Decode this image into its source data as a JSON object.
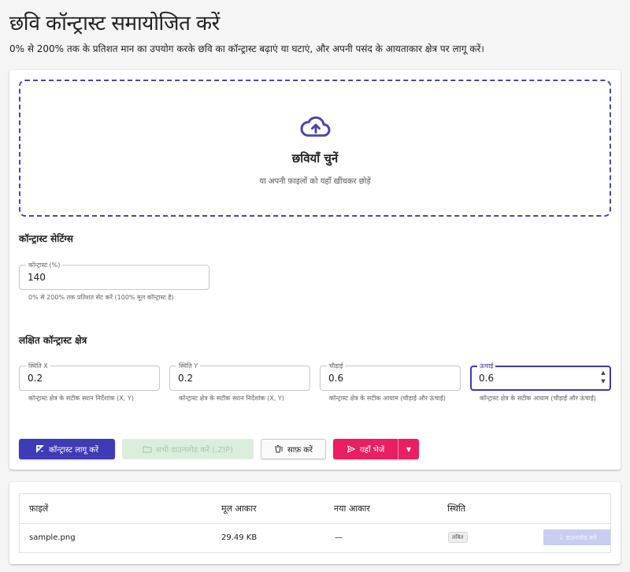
{
  "page": {
    "title": "छवि कॉन्ट्रास्ट समायोजित करें",
    "description": "0% से 200% तक के प्रतिशत मान का उपयोग करके छवि का कॉन्ट्रास्ट बढ़ाएं या घटाएं, और अपनी पसंद के आयताकार क्षेत्र पर लागू करें।"
  },
  "dropzone": {
    "icon": "cloud-upload-icon",
    "title": "छवियाँ चुनें",
    "subtitle": "या अपनी फ़ाइलों को यहाँ खींचकर छोड़ें"
  },
  "contrast_settings": {
    "title": "कॉन्ट्रास्ट सेटिंग्स",
    "contrast_label": "कॉन्ट्रास्ट (%)",
    "contrast_value": "140",
    "contrast_helper": "0% से 200% तक प्रतिशत सेट करें (100% मूल कॉन्ट्रास्ट है)"
  },
  "region": {
    "title": "लक्षित कॉन्ट्रास्ट क्षेत्र",
    "x_label": "स्थिति X",
    "x_value": "0.2",
    "x_helper": "कॉन्ट्रास्ट क्षेत्र के सटीक स्थान निर्देशांक (X, Y)",
    "y_label": "स्थिति Y",
    "y_value": "0.2",
    "y_helper": "कॉन्ट्रास्ट क्षेत्र के सटीक स्थान निर्देशांक (X, Y)",
    "width_label": "चौड़ाई",
    "width_value": "0.6",
    "width_helper": "कॉन्ट्रास्ट क्षेत्र के सटीक आयाम (चौड़ाई और ऊंचाई)",
    "height_label": "ऊंचाई",
    "height_value": "0.6",
    "height_helper": "कॉन्ट्रास्ट क्षेत्र के सटीक आयाम (चौड़ाई और ऊंचाई)"
  },
  "actions": {
    "apply_label": "कॉन्ट्रास्ट लागू करें",
    "download_all_label": "सभी डाउनलोड करें (.ZIP)",
    "clear_label": "साफ़ करें",
    "send_label": "यहाँ भेजें"
  },
  "files_table": {
    "headers": [
      "फ़ाइलें",
      "मूल आकार",
      "नया आकार",
      "स्थिति"
    ],
    "rows": [
      {
        "name": "sample.png",
        "original_size": "29.49 KB",
        "new_size": "—",
        "status": "लंबित",
        "download_label": "डाउनलोड करें"
      }
    ]
  },
  "colors": {
    "primary": "#3f3ab5",
    "accent_pink": "#e91e63",
    "dropzone_border": "#4a47a8",
    "disabled_green": "#dbeedd"
  }
}
